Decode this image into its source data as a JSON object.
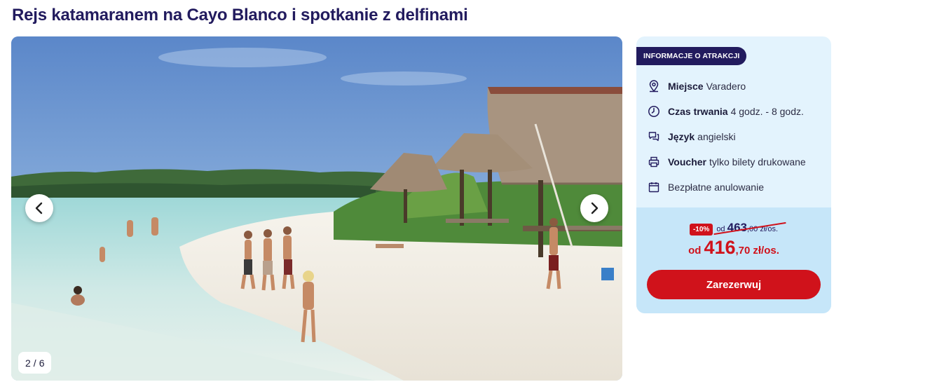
{
  "page": {
    "title": "Rejs katamaranem na Cayo Blanco i spotkanie z delfinami"
  },
  "gallery": {
    "image_subject": "beach-photo",
    "counter_current": "2",
    "counter_separator": "/",
    "counter_total": "6",
    "prev_icon": "chevron-left-icon",
    "next_icon": "chevron-right-icon"
  },
  "info": {
    "badge": "INFORMACJE O ATRAKCJI",
    "rows": [
      {
        "icon": "location-pin-icon",
        "label": "Miejsce",
        "value": "Varadero"
      },
      {
        "icon": "clock-icon",
        "label": "Czas trwania",
        "value": "4 godz. - 8 godz."
      },
      {
        "icon": "speech-bubbles-icon",
        "label": "Język",
        "value": "angielski"
      },
      {
        "icon": "printer-icon",
        "label": "Voucher",
        "value": "tylko bilety drukowane"
      },
      {
        "icon": "calendar-icon",
        "label": "",
        "value": "Bezpłatne anulowanie"
      }
    ]
  },
  "price": {
    "discount": "-10%",
    "old_prefix": "od",
    "old_int": "463",
    "old_dec": ",00",
    "old_unit": "zł/os.",
    "new_prefix": "od",
    "new_int": "416",
    "new_dec": ",70",
    "new_unit": "zł/os.",
    "reserve_label": "Zarezerwuj"
  },
  "colors": {
    "brand_navy": "#221b5e",
    "accent_red": "#d0121b",
    "card_bg": "#e3f3fd",
    "price_bg": "#c6e6f9"
  }
}
